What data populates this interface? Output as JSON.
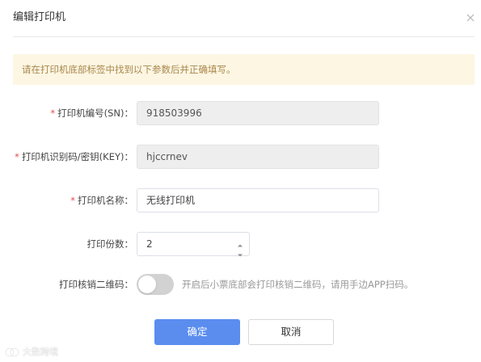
{
  "dialog": {
    "title": "编辑打印机"
  },
  "notice": {
    "text": "请在打印机底部标签中找到以下参数后并正确填写。"
  },
  "form": {
    "sn": {
      "label": "打印机编号(SN)：",
      "value": "918503996",
      "required": true,
      "disabled": true
    },
    "key": {
      "label": "打印机识别码/密钥(KEY)：",
      "value": "hjccrnev",
      "required": true,
      "disabled": true
    },
    "name": {
      "label": "打印机名称：",
      "value": "无线打印机",
      "required": true,
      "disabled": false
    },
    "copies": {
      "label": "打印份数：",
      "value": "2",
      "required": false
    },
    "qrcode": {
      "label": "打印核销二维码：",
      "enabled": false,
      "hint": "开启后小票底部会打印核销二维码，请用手边APP扫码。"
    }
  },
  "buttons": {
    "confirm": "确定",
    "cancel": "取消"
  },
  "watermark": {
    "text": "大数跨境"
  },
  "colors": {
    "primary": "#5b8def",
    "required": "#e34d4d",
    "notice_bg": "#fdf6e3",
    "notice_text": "#a8884c",
    "toggle_off": "#d2d2d2"
  },
  "icons": {
    "close": "close-icon",
    "stepper_up": "chevron-up-icon",
    "stepper_down": "chevron-down-icon"
  }
}
